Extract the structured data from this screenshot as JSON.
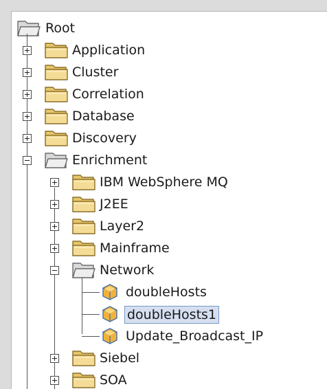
{
  "tree": {
    "root_label": "Root",
    "nodes": [
      {
        "label": "Application",
        "type": "folder",
        "expanded": false
      },
      {
        "label": "Cluster",
        "type": "folder",
        "expanded": false
      },
      {
        "label": "Correlation",
        "type": "folder",
        "expanded": false
      },
      {
        "label": "Database",
        "type": "folder",
        "expanded": false
      },
      {
        "label": "Discovery",
        "type": "folder",
        "expanded": false
      },
      {
        "label": "Enrichment",
        "type": "folder",
        "expanded": true
      },
      {
        "label": "IBM WebSphere MQ",
        "type": "folder",
        "expanded": false
      },
      {
        "label": "J2EE",
        "type": "folder",
        "expanded": false
      },
      {
        "label": "Layer2",
        "type": "folder",
        "expanded": false
      },
      {
        "label": "Mainframe",
        "type": "folder",
        "expanded": false
      },
      {
        "label": "Network",
        "type": "folder",
        "expanded": true
      },
      {
        "label": "doubleHosts",
        "type": "item"
      },
      {
        "label": "doubleHosts1",
        "type": "item",
        "selected": true
      },
      {
        "label": "Update_Broadcast_IP",
        "type": "item"
      },
      {
        "label": "Siebel",
        "type": "folder",
        "expanded": false
      },
      {
        "label": "SOA",
        "type": "folder",
        "expanded": false
      }
    ]
  },
  "colors": {
    "folder_fill": "#f0d890",
    "folder_stroke": "#8a6a18",
    "cube_fill": "#f2b23a",
    "cube_stroke": "#4a7ab8",
    "selection_bg": "#d5dff0",
    "selection_border": "#7a98c6"
  }
}
